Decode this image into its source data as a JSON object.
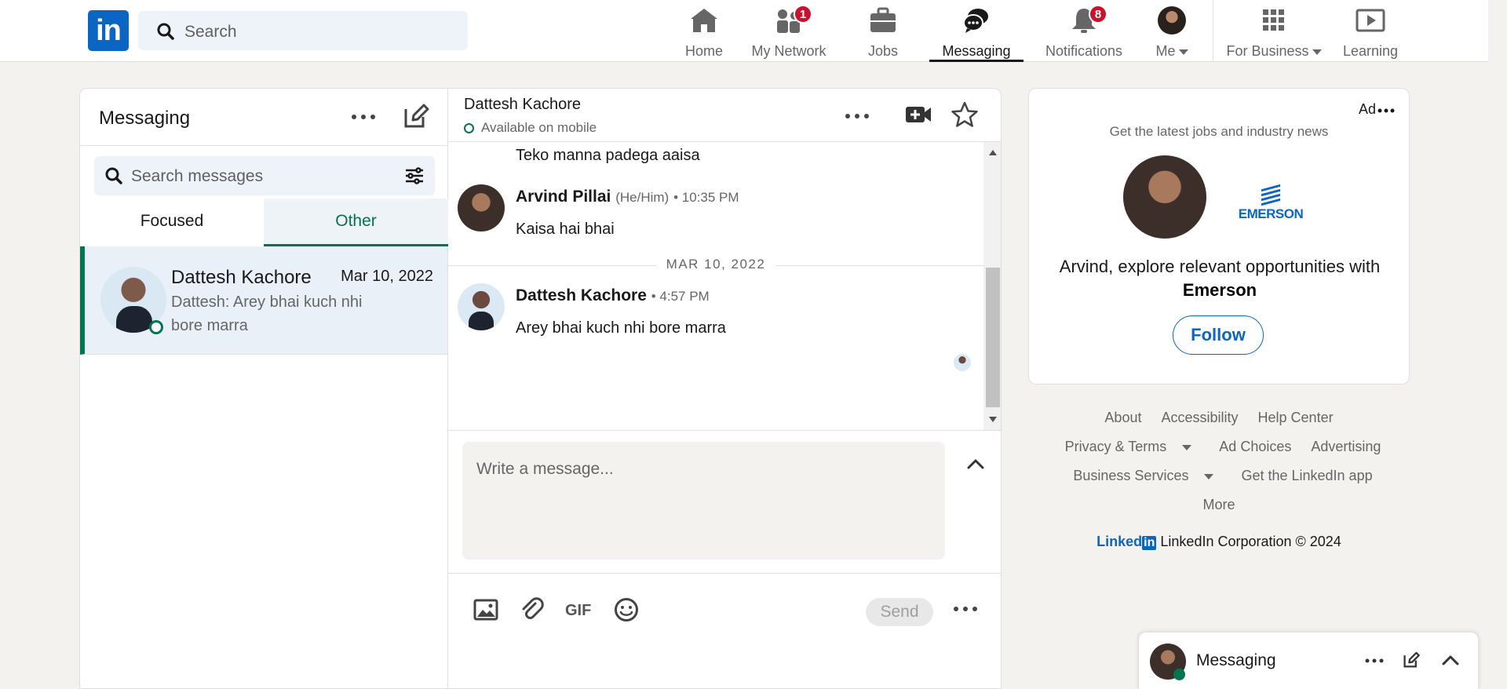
{
  "nav": {
    "logo_text": "in",
    "search_placeholder": "Search",
    "items": [
      {
        "label": "Home",
        "icon": "home-icon"
      },
      {
        "label": "My Network",
        "icon": "network-icon",
        "badge": "1"
      },
      {
        "label": "Jobs",
        "icon": "briefcase-icon"
      },
      {
        "label": "Messaging",
        "icon": "messaging-icon",
        "active": true
      },
      {
        "label": "Notifications",
        "icon": "bell-icon",
        "badge": "8"
      },
      {
        "label": "Me",
        "icon": "avatar"
      },
      {
        "label": "For Business",
        "icon": "grid-icon"
      },
      {
        "label": "Learning",
        "icon": "learning-icon"
      }
    ]
  },
  "messaging": {
    "title": "Messaging",
    "search_placeholder": "Search messages",
    "tabs": [
      {
        "label": "Focused"
      },
      {
        "label": "Other",
        "active": true
      }
    ],
    "conversations": [
      {
        "name": "Dattesh Kachore",
        "date": "Mar 10, 2022",
        "preview": "Dattesh: Arey bhai kuch nhi bore marra"
      }
    ]
  },
  "thread": {
    "contact_name": "Dattesh Kachore",
    "contact_status": "Available on mobile",
    "messages": [
      {
        "text": "Teko manna padega aaisa"
      },
      {
        "sender": "Arvind Pillai",
        "pronouns": "(He/Him)",
        "time": "• 10:35 PM",
        "text": "Kaisa hai bhai"
      },
      {
        "sender": "Dattesh Kachore",
        "time": "• 4:57 PM",
        "text": "Arey bhai kuch nhi bore marra"
      }
    ],
    "day_divider": "MAR 10, 2022",
    "composer_placeholder": "Write a message...",
    "gif_label": "GIF",
    "send_label": "Send"
  },
  "ad": {
    "label": "Ad",
    "tagline": "Get the latest jobs and industry news",
    "company_logo_text": "EMERSON",
    "pitch_prefix": "Arvind, explore relevant opportunities with",
    "pitch_company": "Emerson",
    "follow_label": "Follow"
  },
  "footer": {
    "links_row1": [
      "About",
      "Accessibility",
      "Help Center"
    ],
    "links_row2": [
      "Privacy & Terms",
      "Ad Choices",
      "Advertising"
    ],
    "links_row3": [
      "Business Services",
      "Get the LinkedIn app"
    ],
    "links_row4": [
      "More"
    ],
    "corp_logo_left": "Linked",
    "corp_logo_right": "in",
    "copyright": "LinkedIn Corporation © 2024"
  },
  "floating_bar": {
    "label": "Messaging"
  },
  "colors": {
    "brand_blue": "#0a66c2",
    "active_green": "#01754f",
    "badge_red": "#cb112d",
    "page_bg": "#f4f2ee"
  }
}
